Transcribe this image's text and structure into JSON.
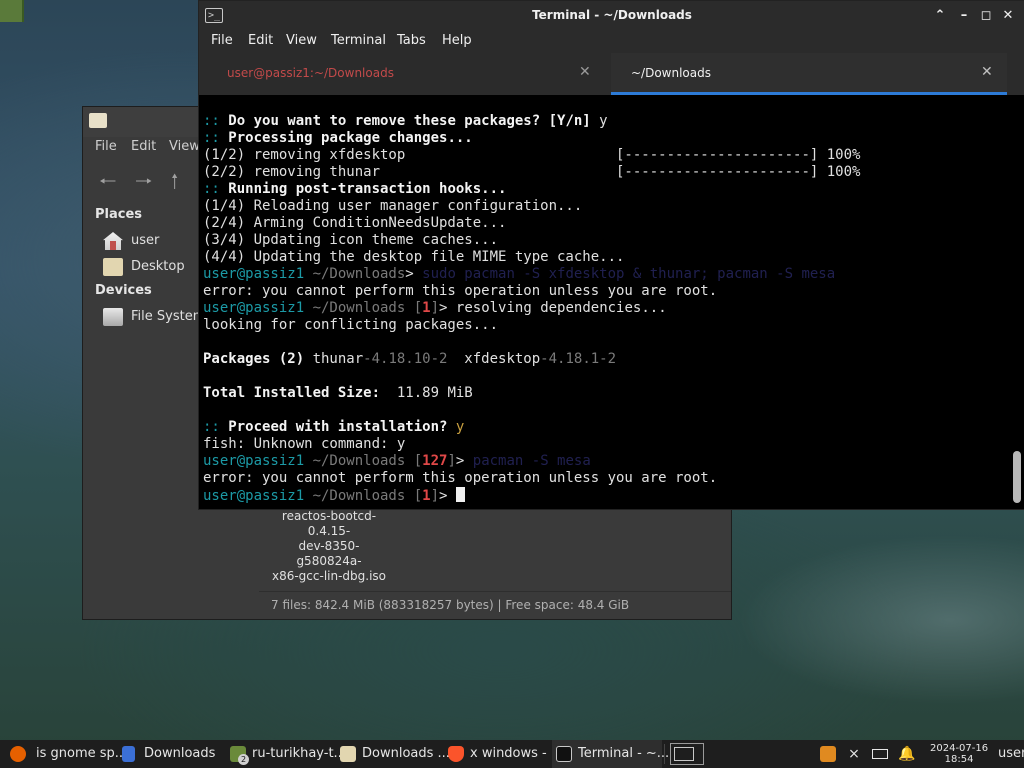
{
  "file_manager": {
    "menu": [
      "File",
      "Edit",
      "View"
    ],
    "sidebar": {
      "places_heading": "Places",
      "places": [
        {
          "label": "user",
          "icon": "home-icon"
        },
        {
          "label": "Desktop",
          "icon": "folder-icon"
        }
      ],
      "devices_heading": "Devices",
      "devices": [
        {
          "label": "File System",
          "icon": "drive-icon"
        }
      ]
    },
    "file_label": "reactos-bootcd-0.4.15-dev-8350-g580824a-x86-gcc-lin-dbg.iso",
    "file_label_lines": [
      "reactos-bootcd-0.4.15-",
      "dev-8350-g580824a-",
      "x86-gcc-lin-dbg.iso"
    ],
    "status": "7 files: 842.4 MiB (883318257 bytes)  |  Free space: 48.4 GiB"
  },
  "terminal": {
    "title": "Terminal - ~/Downloads",
    "menu": [
      "File",
      "Edit",
      "View",
      "Terminal",
      "Tabs",
      "Help"
    ],
    "tabs": [
      {
        "label": "user@passiz1:~/Downloads",
        "active": false
      },
      {
        "label": "~/Downloads",
        "active": true
      }
    ],
    "lines": [
      [
        {
          "t": ":: ",
          "c": "c"
        },
        {
          "t": "Do you want to remove these packages? [Y/n] ",
          "c": "b"
        },
        {
          "t": "y",
          "c": ""
        }
      ],
      [
        {
          "t": ":: ",
          "c": "c"
        },
        {
          "t": "Processing package changes...",
          "c": "b"
        }
      ],
      [
        {
          "t": "(1/2) removing xfdesktop                         [----------------------] 100%",
          "c": ""
        }
      ],
      [
        {
          "t": "(2/2) removing thunar                            [----------------------] 100%",
          "c": ""
        }
      ],
      [
        {
          "t": ":: ",
          "c": "c"
        },
        {
          "t": "Running post-transaction hooks...",
          "c": "b"
        }
      ],
      [
        {
          "t": "(1/4) Reloading user manager configuration...",
          "c": ""
        }
      ],
      [
        {
          "t": "(2/4) Arming ConditionNeedsUpdate...",
          "c": ""
        }
      ],
      [
        {
          "t": "(3/4) Updating icon theme caches...",
          "c": ""
        }
      ],
      [
        {
          "t": "(4/4) Updating the desktop file MIME type cache...",
          "c": ""
        }
      ],
      [
        {
          "t": "user@passiz1 ",
          "c": "c"
        },
        {
          "t": "~/Downloads",
          "c": "g"
        },
        {
          "t": "> ",
          "c": ""
        },
        {
          "t": "sudo pacman -S xfdesktop & thunar; pacman -S mesa",
          "c": "dm"
        }
      ],
      [
        {
          "t": "error: you cannot perform this operation unless you are root.",
          "c": ""
        }
      ],
      [
        {
          "t": "user@passiz1 ",
          "c": "c"
        },
        {
          "t": "~/Downloads ",
          "c": "g"
        },
        {
          "t": "[",
          "c": "g"
        },
        {
          "t": "1",
          "c": "r"
        },
        {
          "t": "]",
          "c": "g"
        },
        {
          "t": "> resolving dependencies...",
          "c": ""
        }
      ],
      [
        {
          "t": "looking for conflicting packages...",
          "c": ""
        }
      ],
      [],
      [
        {
          "t": "Packages (2) ",
          "c": "b"
        },
        {
          "t": "thunar",
          "c": ""
        },
        {
          "t": "-4.18.10-2",
          "c": "g"
        },
        {
          "t": "  xfdesktop",
          "c": ""
        },
        {
          "t": "-4.18.1-2",
          "c": "g"
        }
      ],
      [],
      [
        {
          "t": "Total Installed Size:  ",
          "c": "b"
        },
        {
          "t": "11.89 MiB",
          "c": ""
        }
      ],
      [],
      [
        {
          "t": ":: ",
          "c": "c"
        },
        {
          "t": "Proceed with installation? ",
          "c": "b"
        },
        {
          "t": "y",
          "c": "y"
        }
      ],
      [
        {
          "t": "fish: Unknown command: y",
          "c": ""
        }
      ],
      [
        {
          "t": "user@passiz1 ",
          "c": "c"
        },
        {
          "t": "~/Downloads ",
          "c": "g"
        },
        {
          "t": "[",
          "c": "g"
        },
        {
          "t": "127",
          "c": "r"
        },
        {
          "t": "]",
          "c": "g"
        },
        {
          "t": "> ",
          "c": ""
        },
        {
          "t": "pacman",
          "c": "dm"
        },
        {
          "t": " -S mesa",
          "c": "dm"
        }
      ],
      [
        {
          "t": "error: you cannot perform this operation unless you are root.",
          "c": ""
        }
      ],
      [
        {
          "t": "user@passiz1 ",
          "c": "c"
        },
        {
          "t": "~/Downloads ",
          "c": "g"
        },
        {
          "t": "[",
          "c": "g"
        },
        {
          "t": "1",
          "c": "r"
        },
        {
          "t": "]",
          "c": "g"
        },
        {
          "t": "> ",
          "c": ""
        },
        {
          "t": "",
          "c": "cursor"
        }
      ]
    ]
  },
  "taskbar": {
    "items": [
      {
        "label": "is gnome sp...",
        "icon": "firefox-icon",
        "color": "#e66000"
      },
      {
        "label": "Downloads",
        "icon": "document-icon",
        "color": "#3b6fd6"
      },
      {
        "label": "ru-turikhay-t...",
        "icon": "minecraft-launcher-icon",
        "color": "#6a8a3a"
      },
      {
        "label": "Downloads ...",
        "icon": "folder-icon",
        "color": "#e2d6b0"
      },
      {
        "label": "x windows - ...",
        "icon": "brave-icon",
        "color": "#fb542b"
      },
      {
        "label": "Terminal - ~...",
        "icon": "terminal-icon",
        "color": "#2b2b2b"
      }
    ],
    "badge": "2",
    "clock_date": "2024-07-16",
    "clock_time": "18:54",
    "user": "user"
  }
}
